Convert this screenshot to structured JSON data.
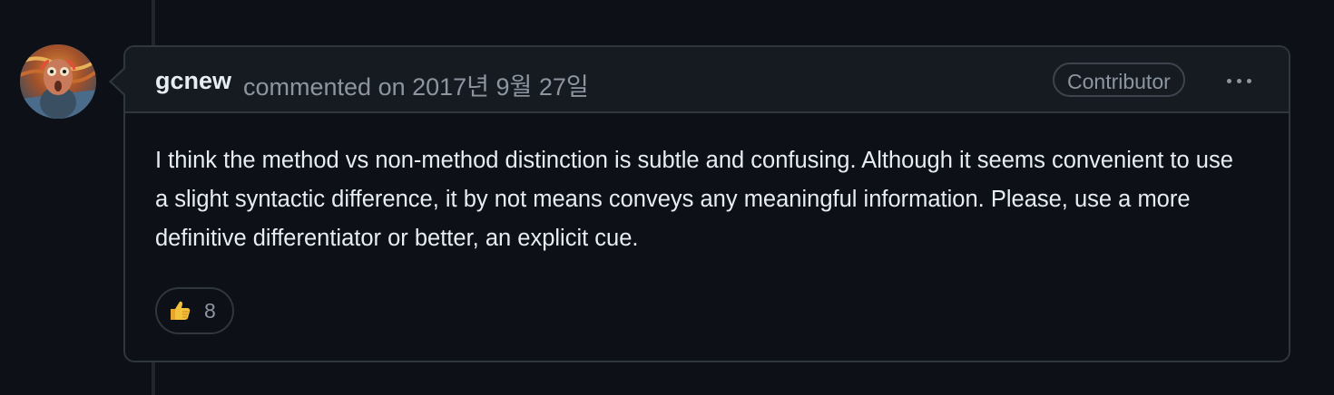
{
  "comment": {
    "author": "gcnew",
    "meta": "commented on 2017년 9월 27일",
    "badge": "Contributor",
    "more_icon": "kebab-horizontal-icon",
    "body": [
      "I think the method vs non-method distinction is subtle and confusing. Although it seems convenient to use a slight syntactic difference, it by not means conveys any meaningful information. Please, use a more definitive differentiator or better, an explicit cue."
    ],
    "reactions": [
      {
        "icon": "thumbs-up-icon",
        "count": "8"
      }
    ]
  },
  "colors": {
    "background": "#0d1117",
    "header_bg": "#161b22",
    "border": "#30363d",
    "text": "#e6edf3",
    "muted": "#8d96a0"
  }
}
